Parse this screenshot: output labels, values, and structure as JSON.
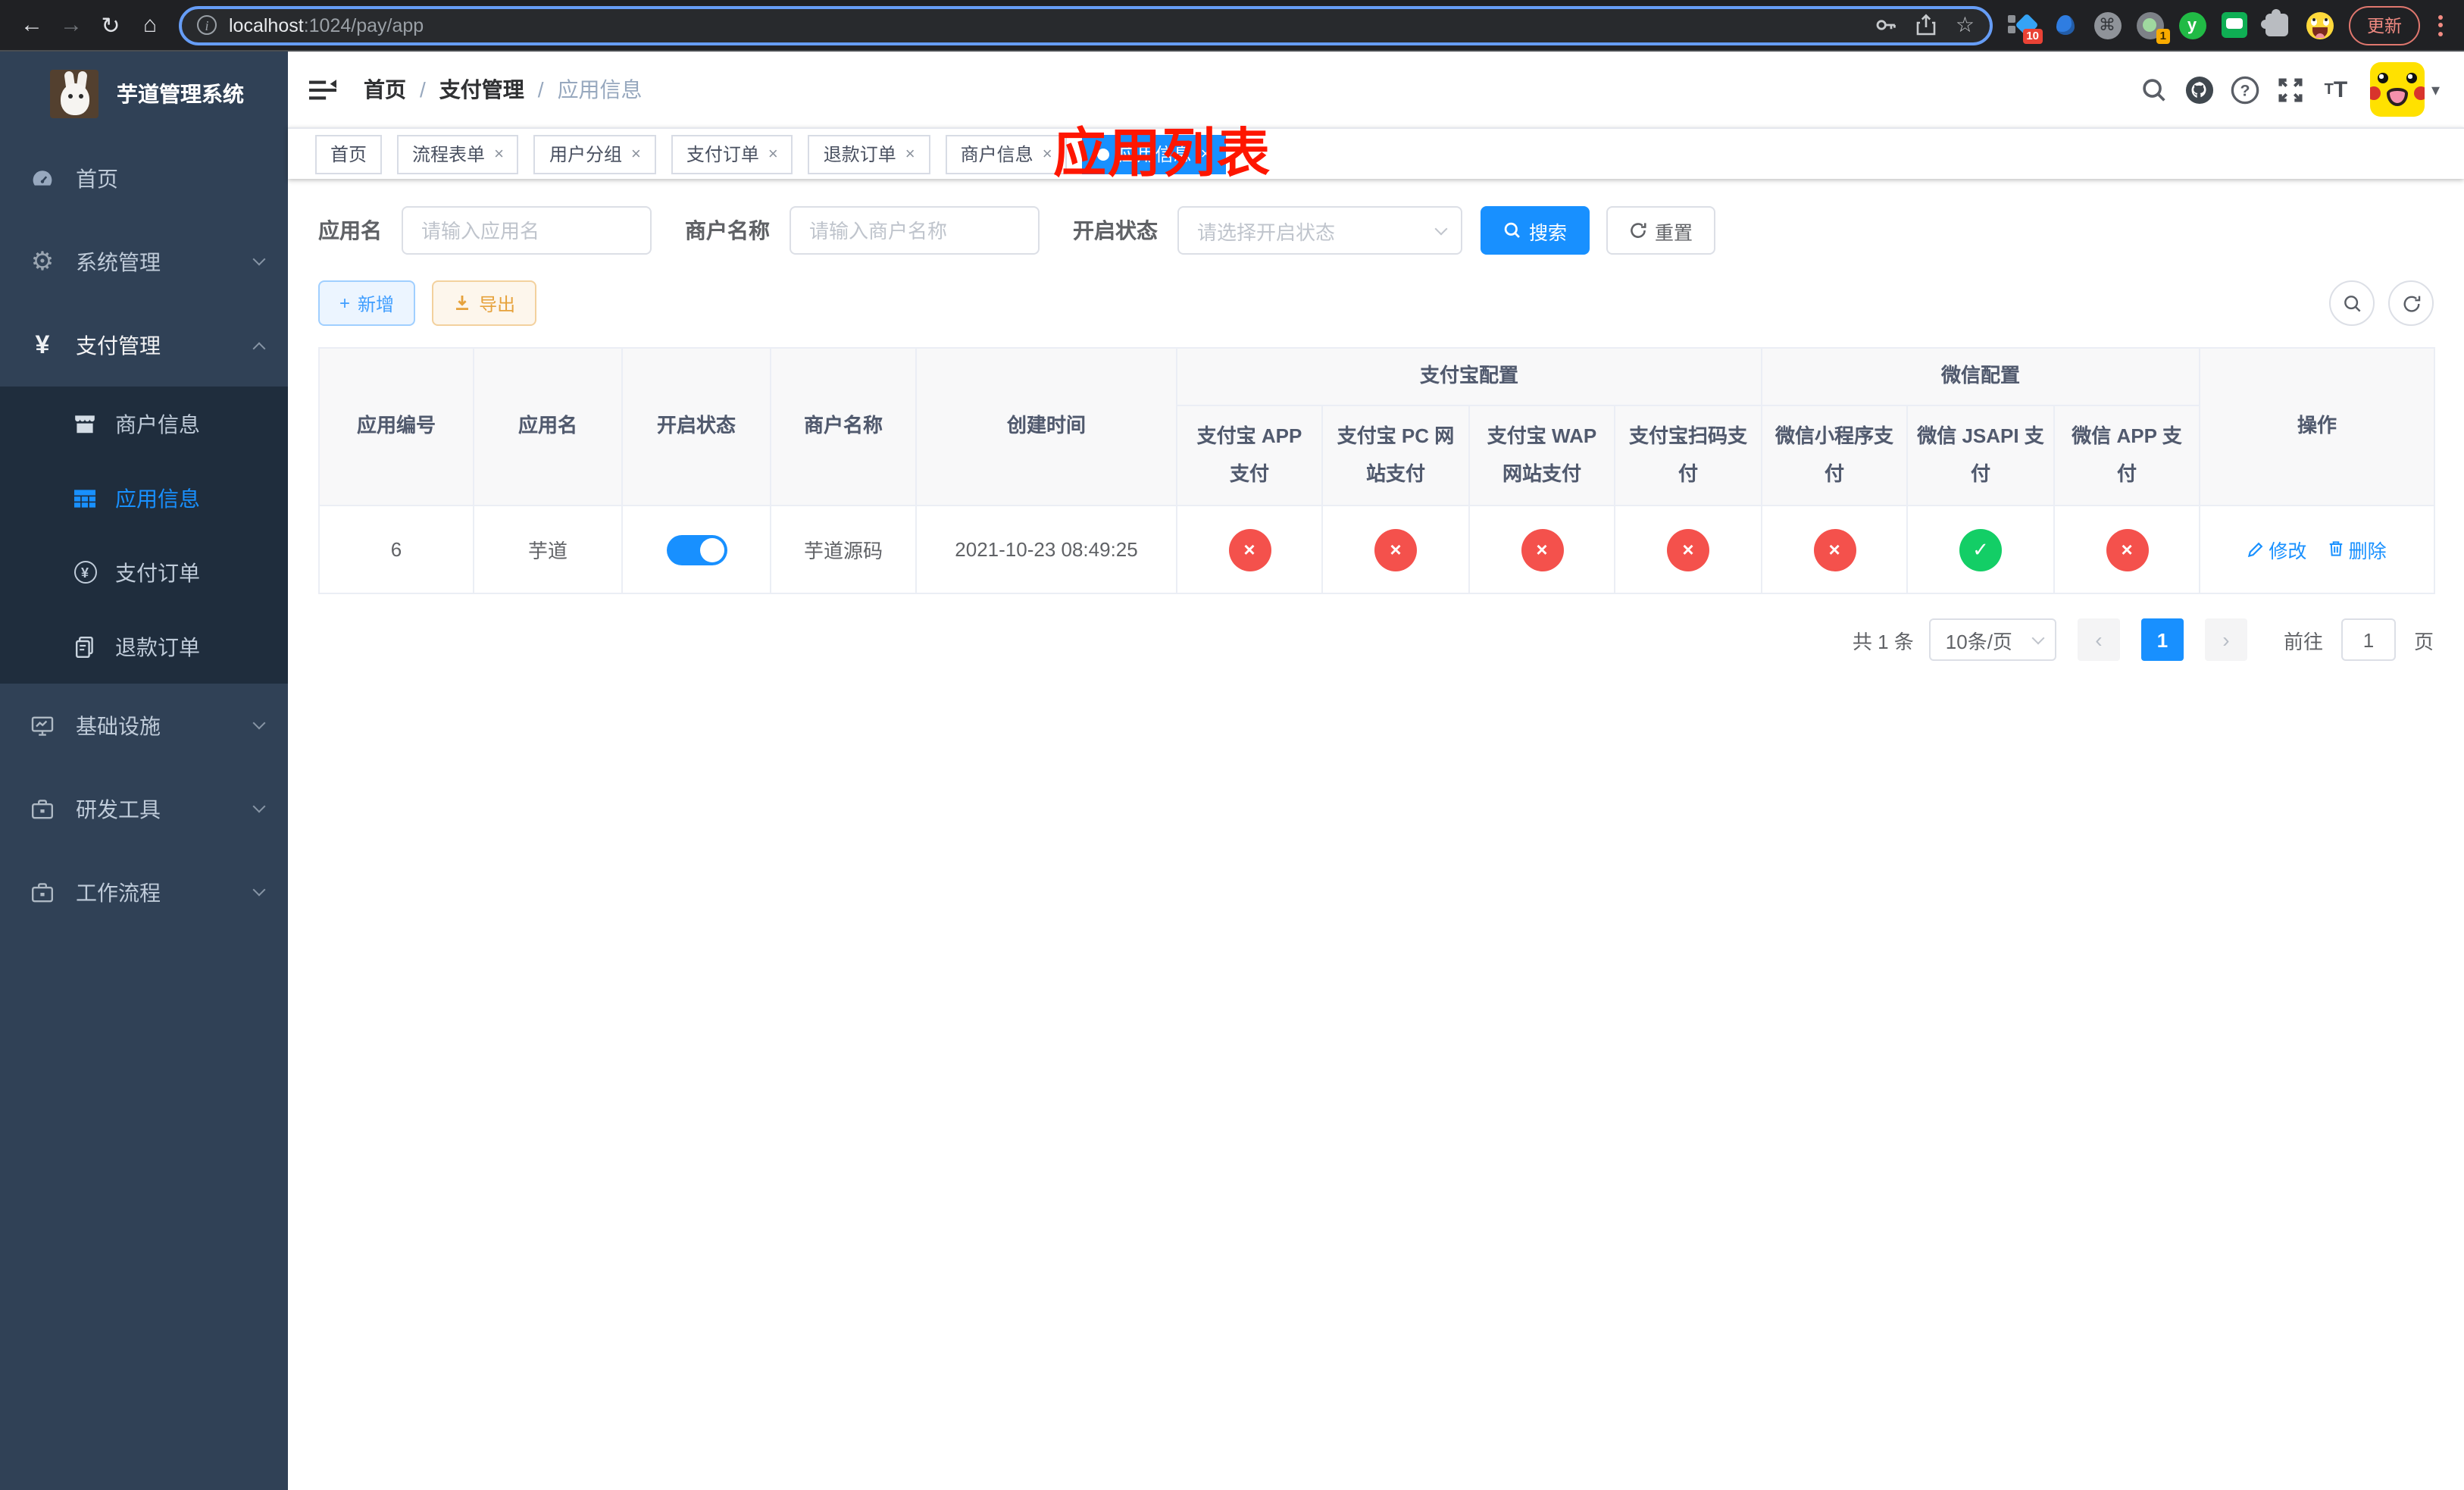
{
  "browser": {
    "url_host": "localhost",
    "url_rest": ":1024/pay/app",
    "update_button": "更新",
    "ext_badge_10": "10",
    "ext_badge_1": "1",
    "ext_y_letter": "y"
  },
  "icons": {
    "back": "←",
    "forward": "→",
    "reload": "↻",
    "home": "⌂",
    "info": "i",
    "star": "☆",
    "cmd": "⌘",
    "gear": "⚙",
    "yen": "¥",
    "yen_small": "¥",
    "caret_down": "▾",
    "slash": "/",
    "plus": "+",
    "cross": "×",
    "check": "✓",
    "prev": "‹",
    "next": "›",
    "close": "×",
    "font_small": "T",
    "font_large": "T"
  },
  "sidebar": {
    "logo_title": "芋道管理系统",
    "menu": [
      {
        "label": "首页"
      },
      {
        "label": "系统管理"
      },
      {
        "label": "支付管理"
      }
    ],
    "submenu": [
      {
        "label": "商户信息"
      },
      {
        "label": "应用信息",
        "active": true
      },
      {
        "label": "支付订单"
      },
      {
        "label": "退款订单"
      }
    ],
    "menu_bottom": [
      {
        "label": "基础设施"
      },
      {
        "label": "研发工具"
      },
      {
        "label": "工作流程"
      }
    ]
  },
  "header": {
    "breadcrumb": [
      "首页",
      "支付管理",
      "应用信息"
    ],
    "annotation": "应用列表"
  },
  "tabs": [
    {
      "label": "首页",
      "closable": false,
      "active": false
    },
    {
      "label": "流程表单",
      "closable": true,
      "active": false
    },
    {
      "label": "用户分组",
      "closable": true,
      "active": false
    },
    {
      "label": "支付订单",
      "closable": true,
      "active": false
    },
    {
      "label": "退款订单",
      "closable": true,
      "active": false
    },
    {
      "label": "商户信息",
      "closable": true,
      "active": false
    },
    {
      "label": "应用信息",
      "closable": true,
      "active": true
    }
  ],
  "filters": {
    "app_name_label": "应用名",
    "app_name_placeholder": "请输入应用名",
    "merchant_label": "商户名称",
    "merchant_placeholder": "请输入商户名称",
    "status_label": "开启状态",
    "status_placeholder": "请选择开启状态",
    "search_button": "搜索",
    "reset_button": "重置"
  },
  "toolbar": {
    "add_button": "新增",
    "export_button": "导出"
  },
  "table": {
    "columns": [
      "应用编号",
      "应用名",
      "开启状态",
      "商户名称",
      "创建时间"
    ],
    "groups": [
      {
        "label": "支付宝配置"
      },
      {
        "label": "微信配置"
      }
    ],
    "sub_columns": [
      "支付宝 APP 支付",
      "支付宝 PC 网站支付",
      "支付宝 WAP 网站支付",
      "支付宝扫码支付",
      "微信小程序支付",
      "微信 JSAPI 支付",
      "微信 APP 支付"
    ],
    "operation_column": "操作",
    "row": {
      "id": "6",
      "name": "芋道",
      "status_on": true,
      "merchant": "芋道源码",
      "created_at": "2021-10-23 08:49:25",
      "channels": [
        {
          "name": "支付宝 APP 支付",
          "enabled": false
        },
        {
          "name": "支付宝 PC 网站支付",
          "enabled": false
        },
        {
          "name": "支付宝 WAP 网站支付",
          "enabled": false
        },
        {
          "name": "支付宝扫码支付",
          "enabled": false
        },
        {
          "name": "微信小程序支付",
          "enabled": false
        },
        {
          "name": "微信 JSAPI 支付",
          "enabled": true
        },
        {
          "name": "微信 APP 支付",
          "enabled": false
        }
      ],
      "edit_label": "修改",
      "delete_label": "删除"
    }
  },
  "pagination": {
    "total": "共 1 条",
    "page_size": "10条/页",
    "current_page": "1",
    "goto_label": "前往",
    "goto_value": "1",
    "goto_suffix": "页"
  },
  "colors": {
    "primary": "#1890ff",
    "danger": "#f4514c",
    "success": "#13ce66",
    "warning": "#e6a23c",
    "sidebar_bg": "#304156",
    "submenu_bg": "#1f2d3d",
    "annotation_red": "#fe1600"
  }
}
